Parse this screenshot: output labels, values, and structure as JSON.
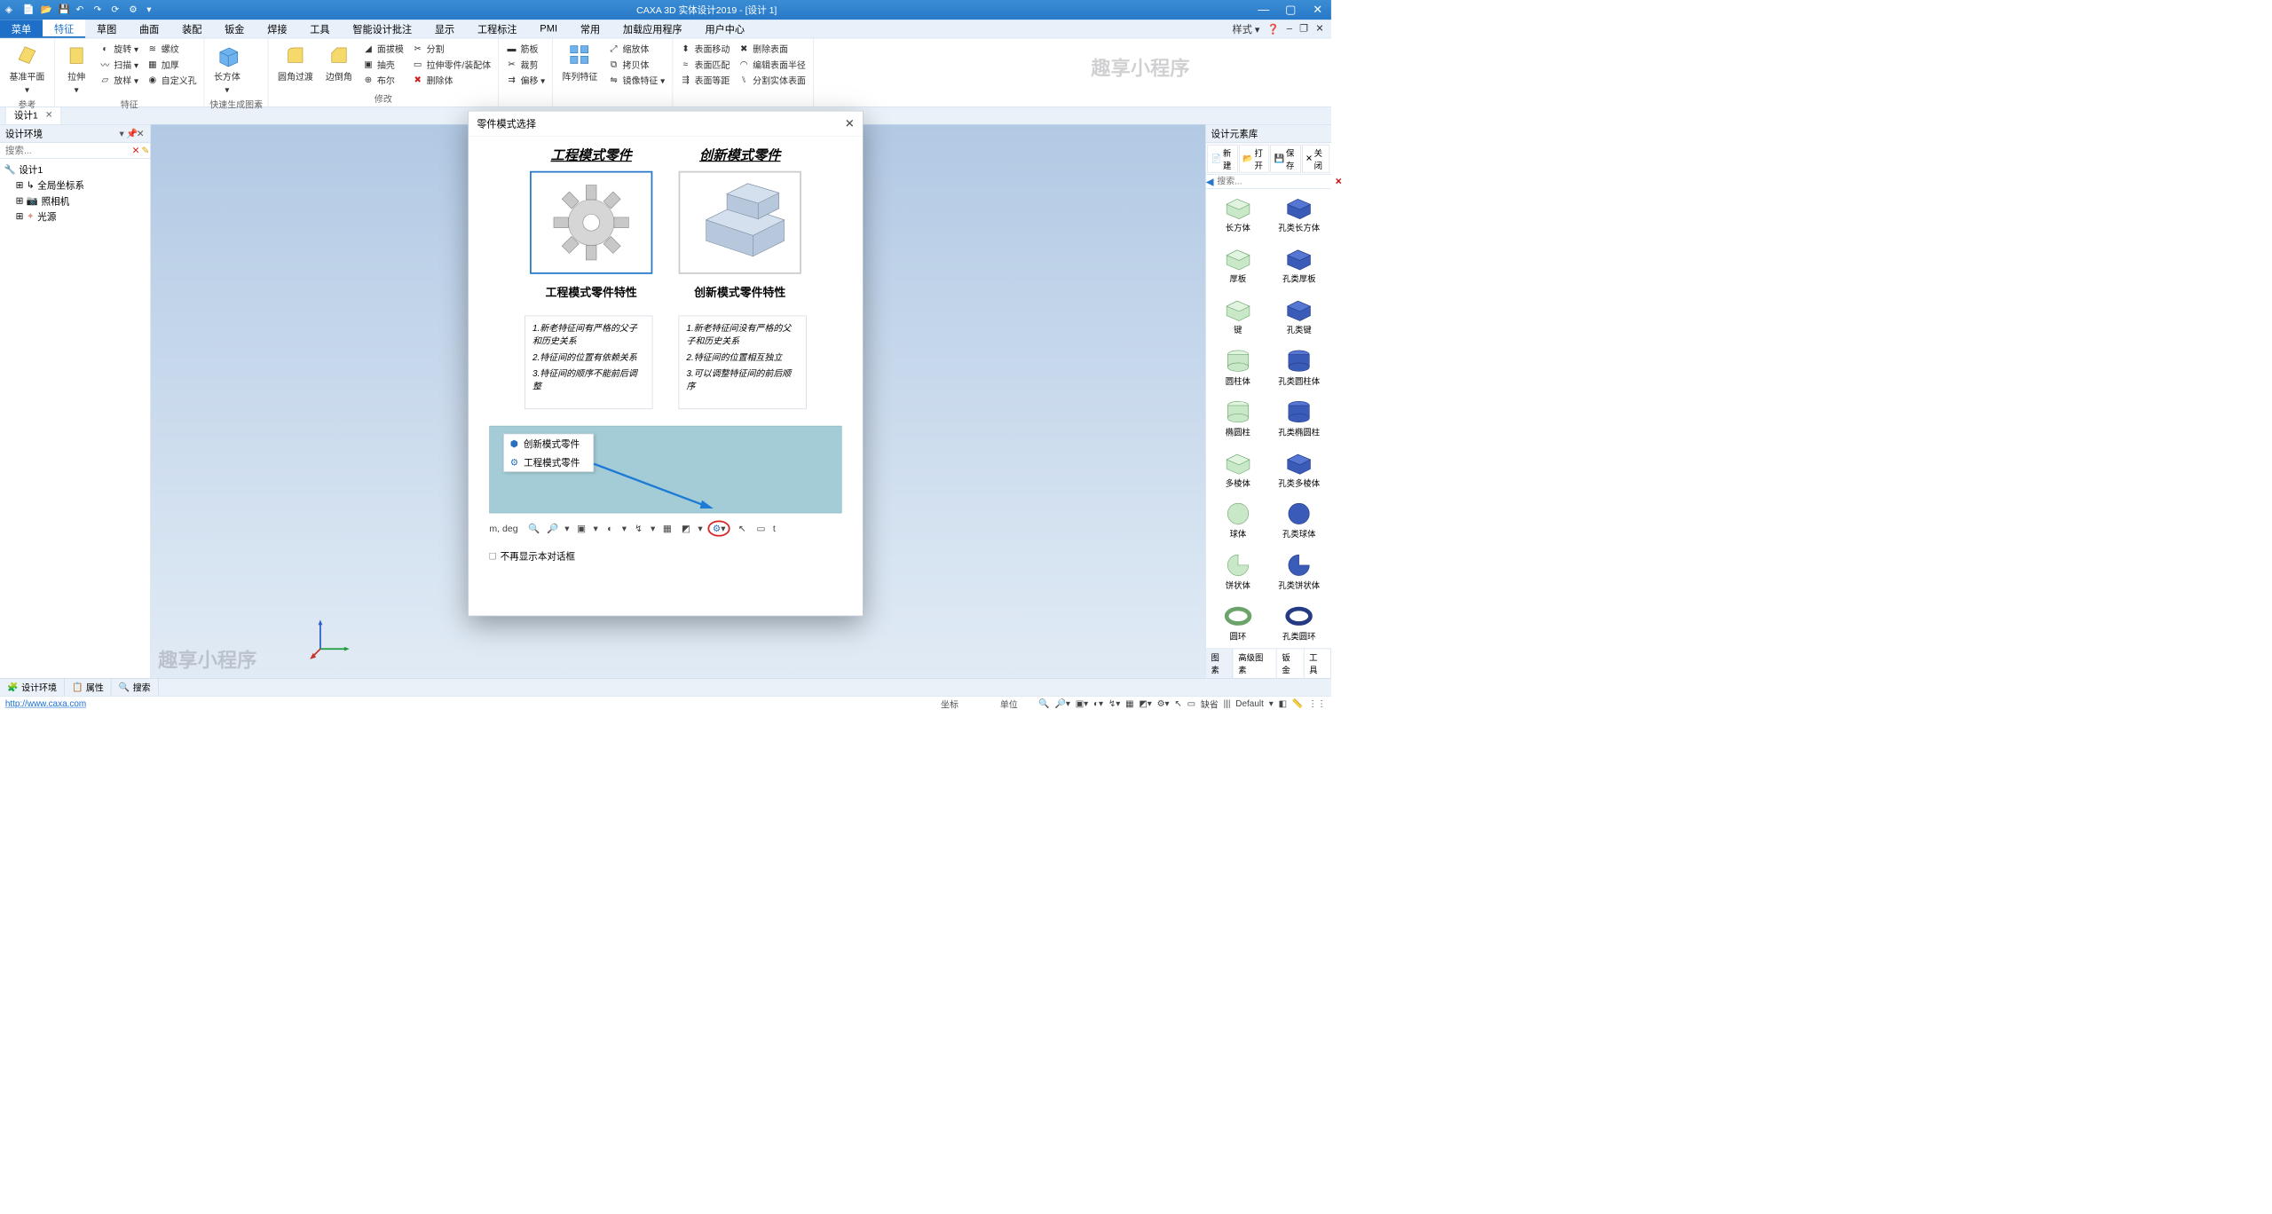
{
  "titlebar": {
    "title": "CAXA 3D 实体设计2019 - [设计 1]"
  },
  "menubar": {
    "items": [
      "菜单",
      "特征",
      "草图",
      "曲面",
      "装配",
      "钣金",
      "焊接",
      "工具",
      "智能设计批注",
      "显示",
      "工程标注",
      "PMI",
      "常用",
      "加载应用程序",
      "用户中心"
    ],
    "right_style": "样式 ▾"
  },
  "ribbon": {
    "groups": [
      {
        "label": "参考",
        "big": [
          {
            "name": "基准平面",
            "icon": "plane"
          }
        ]
      },
      {
        "label": "特征",
        "big": [
          {
            "name": "拉伸",
            "icon": "extrude"
          }
        ],
        "small": [
          [
            "旋转 ▾",
            "螺纹"
          ],
          [
            "扫描 ▾",
            "加厚"
          ],
          [
            "放样 ▾",
            "自定义孔"
          ]
        ]
      },
      {
        "label": "快速生成图素",
        "big": [
          {
            "name": "长方体",
            "icon": "cube"
          }
        ]
      },
      {
        "label": "修改",
        "big": [
          {
            "name": "圆角过渡",
            "icon": "fillet"
          },
          {
            "name": "边倒角",
            "icon": "chamfer"
          }
        ],
        "small": [
          [
            "面拔模",
            "分割"
          ],
          [
            "抽壳",
            "拉伸零件/装配体"
          ],
          [
            "布尔",
            "删除体"
          ]
        ]
      },
      {
        "label": "",
        "big": [],
        "small": [
          [
            "筋板"
          ],
          [
            "裁剪"
          ],
          [
            "偏移 ▾"
          ]
        ]
      },
      {
        "label": "",
        "big": [
          {
            "name": "阵列特征",
            "icon": "pattern"
          }
        ],
        "small": [
          [
            "缩放体"
          ],
          [
            "拷贝体"
          ],
          [
            "镜像特征 ▾"
          ]
        ]
      },
      {
        "label": "",
        "big": [],
        "small": [
          [
            "表面移动",
            "删除表面"
          ],
          [
            "表面匹配",
            "编辑表面半径"
          ],
          [
            "表面等距",
            "分割实体表面"
          ]
        ]
      }
    ]
  },
  "doctab": {
    "name": "设计1"
  },
  "leftpanel": {
    "title": "设计环境",
    "search": "搜索...",
    "tree": [
      {
        "name": "设计1",
        "icon": "doc"
      },
      {
        "name": "全局坐标系",
        "icon": "axis",
        "indent": true,
        "prefix": "⊞"
      },
      {
        "name": "照相机",
        "icon": "camera",
        "indent": true,
        "prefix": "⊞"
      },
      {
        "name": "光源",
        "icon": "light",
        "indent": true,
        "prefix": "⊞"
      }
    ]
  },
  "rightpanel": {
    "title": "设计元素库",
    "toolbar": [
      "新建",
      "打开",
      "保存",
      "关闭"
    ],
    "search": "搜索...",
    "items": [
      {
        "label": "长方体",
        "shape": "cube"
      },
      {
        "label": "孔类长方体",
        "shape": "cube-hole"
      },
      {
        "label": "厚板",
        "shape": "slab"
      },
      {
        "label": "孔类厚板",
        "shape": "slab-hole"
      },
      {
        "label": "键",
        "shape": "key"
      },
      {
        "label": "孔类键",
        "shape": "key-hole"
      },
      {
        "label": "圆柱体",
        "shape": "cyl"
      },
      {
        "label": "孔类圆柱体",
        "shape": "cyl-hole"
      },
      {
        "label": "椭圆柱",
        "shape": "ecyl"
      },
      {
        "label": "孔类椭圆柱",
        "shape": "ecyl-hole"
      },
      {
        "label": "多棱体",
        "shape": "poly"
      },
      {
        "label": "孔类多棱体",
        "shape": "poly-hole"
      },
      {
        "label": "球体",
        "shape": "sphere"
      },
      {
        "label": "孔类球体",
        "shape": "sphere-hole"
      },
      {
        "label": "饼状体",
        "shape": "pie"
      },
      {
        "label": "孔类饼状体",
        "shape": "pie-hole"
      },
      {
        "label": "圆环",
        "shape": "torus"
      },
      {
        "label": "孔类圆环",
        "shape": "torus-hole"
      }
    ],
    "tabs": [
      "图素",
      "高级图素",
      "钣金",
      "工具"
    ]
  },
  "bottombar": {
    "tabs": [
      "设计环境",
      "属性",
      "搜索"
    ]
  },
  "statusbar": {
    "url": "http://www.caxa.com",
    "coord": "坐标",
    "unit": "单位",
    "missing": "缺省",
    "default": "Default"
  },
  "dialog": {
    "title": "零件模式选择",
    "left": {
      "title": "工程模式零件",
      "sub": "工程模式零件特性",
      "desc": [
        "1.新老特征间有严格的父子和历史关系",
        "2.特征间的位置有依赖关系",
        "3.特征间的顺序不能前后调整"
      ]
    },
    "right": {
      "title": "创新模式零件",
      "sub": "创新模式零件特性",
      "desc": [
        "1.新老特征间没有严格的父子和历史关系",
        "2.特征间的位置相互独立",
        "3.可以调整特征间的前后顺序"
      ]
    },
    "popup": [
      "创新模式零件",
      "工程模式零件"
    ],
    "units": "m, deg",
    "checkbox": "不再显示本对话框"
  },
  "watermarks": [
    "趣享小程序",
    "趣享小程序",
    "趣享小程序"
  ]
}
